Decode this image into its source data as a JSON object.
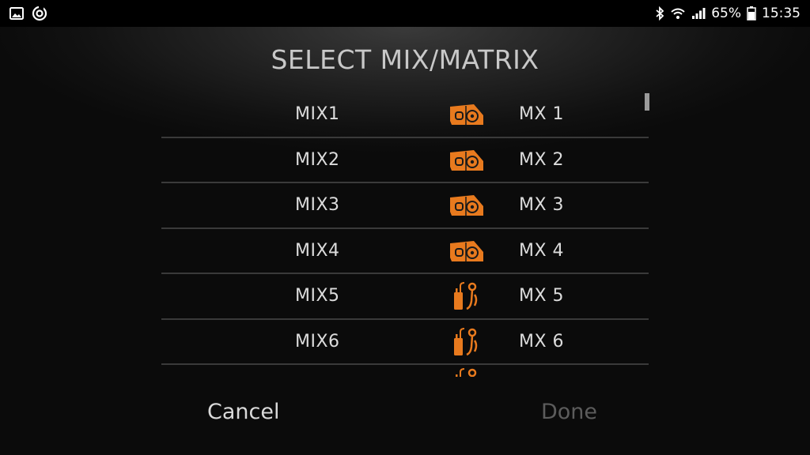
{
  "status_bar": {
    "battery": "65%",
    "time": "15:35",
    "left_icons": [
      "gallery-icon",
      "sync-icon"
    ],
    "right_icons": [
      "bluetooth-icon",
      "wifi-icon",
      "signal-icon",
      "battery-icon"
    ]
  },
  "dialog": {
    "title": "SELECT MIX/MATRIX",
    "rows": [
      {
        "name": "MIX1",
        "icon": "floor-wedge-monitor-icon",
        "label": "MX 1"
      },
      {
        "name": "MIX2",
        "icon": "floor-wedge-monitor-icon",
        "label": "MX 2"
      },
      {
        "name": "MIX3",
        "icon": "floor-wedge-monitor-icon",
        "label": "MX 3"
      },
      {
        "name": "MIX4",
        "icon": "floor-wedge-monitor-icon",
        "label": "MX 4"
      },
      {
        "name": "MIX5",
        "icon": "in-ear-monitor-icon",
        "label": "MX 5"
      },
      {
        "name": "MIX6",
        "icon": "in-ear-monitor-icon",
        "label": "MX 6"
      }
    ],
    "partial_row_icon": "in-ear-monitor-icon",
    "cancel_label": "Cancel",
    "done_label": "Done"
  },
  "colors": {
    "accent": "#e87a1e",
    "done_disabled": "#5c5c5c"
  }
}
